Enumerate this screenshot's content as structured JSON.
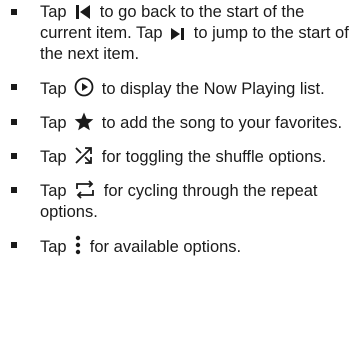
{
  "instructions": [
    {
      "icon": "skip-back-icon",
      "text_before": "Tap",
      "text_after": "to go back to the start of the current item. Tap",
      "icon2": "skip-forward-icon",
      "text_after2": "to jump to the start of the next item."
    },
    {
      "icon": "now-playing-icon",
      "text_before": "Tap",
      "text_after": "to display the Now Playing list."
    },
    {
      "icon": "star-icon",
      "text_before": "Tap",
      "text_after": "to add the song to your favorites."
    },
    {
      "icon": "shuffle-icon",
      "text_before": "Tap",
      "text_after": "for toggling the shuffle options."
    },
    {
      "icon": "repeat-icon",
      "text_before": "Tap",
      "text_after": "for cycling through the repeat options."
    },
    {
      "icon": "more-options-icon",
      "text_before": "Tap",
      "text_after": "for available options."
    }
  ],
  "colors": {
    "text": "#1a1a1a",
    "background": "#ffffff"
  }
}
